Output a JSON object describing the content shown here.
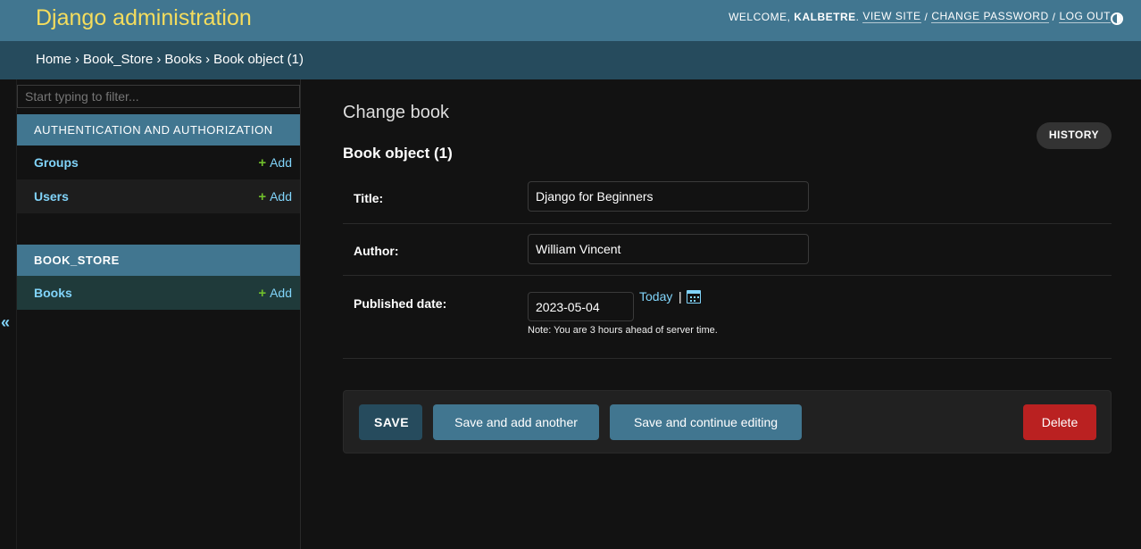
{
  "header": {
    "branding": "Django administration",
    "welcome": "WELCOME,",
    "username": "KALBETRE",
    "view_site": "VIEW SITE",
    "change_password": "CHANGE PASSWORD",
    "log_out": "LOG OUT",
    "separator": "/",
    "dot": ".",
    "color": "#417690",
    "branding_color": "#f5dd5d"
  },
  "breadcrumbs": {
    "items": [
      "Home",
      "Book_Store",
      "Books",
      "Book object (1)"
    ],
    "separator": "›"
  },
  "sidebar": {
    "filter_placeholder": "Start typing to filter...",
    "collapse_icon": "«",
    "modules": [
      {
        "caption": "AUTHENTICATION AND AUTHORIZATION",
        "models": [
          {
            "name": "Groups",
            "add": "Add"
          },
          {
            "name": "Users",
            "add": "Add"
          }
        ]
      },
      {
        "caption": "BOOK_STORE",
        "models": [
          {
            "name": "Books",
            "add": "Add"
          }
        ]
      }
    ]
  },
  "main": {
    "page_title": "Change book",
    "history_button": "HISTORY",
    "object_title": "Book object (1)",
    "fields": {
      "title": {
        "label": "Title:",
        "value": "Django for Beginners"
      },
      "author": {
        "label": "Author:",
        "value": "William Vincent"
      },
      "published_date": {
        "label": "Published date:",
        "value": "2023-05-04",
        "today_link": "Today",
        "pipe": "|",
        "note": "Note: You are 3 hours ahead of server time."
      }
    },
    "buttons": {
      "save": "SAVE",
      "save_add_another": "Save and add another",
      "save_continue": "Save and continue editing",
      "delete": "Delete"
    }
  }
}
